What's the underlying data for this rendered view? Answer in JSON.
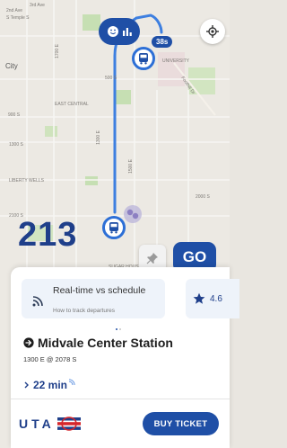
{
  "colors": {
    "brand": "#1f4fa6",
    "route_line": "#3d7fe0",
    "map_bg": "#ece9e3",
    "park": "#c6dfb3"
  },
  "map": {
    "labels": [
      {
        "text": "2nd Ave",
        "class": ""
      },
      {
        "text": "3rd Ave",
        "class": ""
      },
      {
        "text": "S Temple S",
        "class": ""
      },
      {
        "text": "City",
        "class": "big"
      },
      {
        "text": "500 S",
        "class": ""
      },
      {
        "text": "EAST CENTRAL",
        "class": ""
      },
      {
        "text": "900 S",
        "class": ""
      },
      {
        "text": "1300 S",
        "class": ""
      },
      {
        "text": "LIBERTY WELLS",
        "class": ""
      },
      {
        "text": "2100 S",
        "class": ""
      },
      {
        "text": "UNIVERSITY",
        "class": ""
      },
      {
        "text": "1700 E",
        "class": ""
      },
      {
        "text": "1300 E",
        "class": ""
      },
      {
        "text": "Foothill Dr",
        "class": ""
      },
      {
        "text": "1500 E",
        "class": ""
      },
      {
        "text": "2000 S",
        "class": ""
      },
      {
        "text": "SUGAR HOUSE",
        "class": ""
      }
    ],
    "top_badge": {
      "icons": [
        "smiley-icon",
        "bar-chart-icon"
      ]
    },
    "arrival_badge": "38s",
    "locate_icon": "crosshair-icon"
  },
  "route": {
    "number": "213",
    "go_label": "GO",
    "pin_icon": "pin-icon"
  },
  "info_card": {
    "title": "Real-time vs schedule",
    "subtitle": "How to track departures",
    "icon": "signal-icon"
  },
  "rating": {
    "value": "4.6",
    "icon": "star-icon"
  },
  "carousel": {
    "count": 2,
    "active": 0
  },
  "station": {
    "name": "Midvale Center Station",
    "subtitle": "1300 E @ 2078 S",
    "icon": "arrow-circle-icon"
  },
  "eta": {
    "value": "22 min",
    "icon": "chevron-right-icon",
    "realtime_icon": "realtime-icon"
  },
  "footer": {
    "logo_text": "UTA",
    "buy_label": "BUY TICKET"
  }
}
